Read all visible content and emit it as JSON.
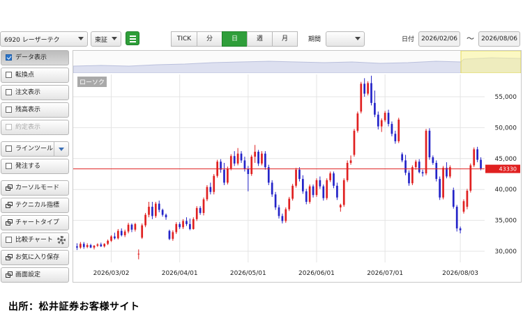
{
  "toolbar": {
    "stock_select": "6920 レーザーテク",
    "market_select": "東証",
    "period_tabs": [
      "TICK",
      "分",
      "日",
      "週",
      "月"
    ],
    "active_tab": "日",
    "period_label": "期間",
    "period_value": "",
    "date_label": "日付",
    "date_from": "2026/02/06",
    "date_sep": "～",
    "date_to": "2026/08/06"
  },
  "sidebar": {
    "items": [
      {
        "label": "データ表示",
        "kind": "checkbox",
        "checked": true,
        "active": true
      },
      {
        "label": "転換点",
        "kind": "checkbox"
      },
      {
        "label": "注文表示",
        "kind": "checkbox"
      },
      {
        "label": "残高表示",
        "kind": "checkbox"
      },
      {
        "label": "約定表示",
        "kind": "checkbox",
        "disabled": true
      },
      {
        "label": "ラインツール",
        "kind": "checkbox-dropdown"
      },
      {
        "label": "発注する",
        "kind": "checkbox"
      },
      {
        "label": "カーソルモード",
        "kind": "window"
      },
      {
        "label": "テクニカル指標",
        "kind": "window"
      },
      {
        "label": "チャートタイプ",
        "kind": "window"
      },
      {
        "label": "比較チャート",
        "kind": "checkbox-gear"
      },
      {
        "label": "お気に入り保存",
        "kind": "window"
      },
      {
        "label": "画面設定",
        "kind": "window"
      }
    ]
  },
  "chart_data": {
    "type": "candlestick",
    "title": "ローソク",
    "y_ticks": [
      "55,000",
      "50,000",
      "45,000",
      "40,000",
      "35,000",
      "30,000"
    ],
    "y_tick_values": [
      55000,
      50000,
      45000,
      40000,
      35000,
      30000
    ],
    "ylim": [
      28200,
      58600
    ],
    "x_ticks": [
      "2026/03/02",
      "2026/04/01",
      "2026/05/01",
      "2026/06/01",
      "2026/07/01",
      "2026/08/03"
    ],
    "x_tick_index": [
      10,
      30,
      50,
      70,
      90,
      112
    ],
    "current_price": 43330,
    "current_price_label": "43330",
    "up_color": "#e02020",
    "down_color": "#2424c8",
    "ohlc": [
      [
        30800,
        31300,
        30200,
        30600
      ],
      [
        30600,
        31500,
        30400,
        31200
      ],
      [
        31200,
        31500,
        30400,
        30700
      ],
      [
        30700,
        31300,
        30500,
        31000
      ],
      [
        31000,
        31200,
        30500,
        30600
      ],
      [
        30600,
        31000,
        30300,
        30900
      ],
      [
        30900,
        31300,
        30700,
        31100
      ],
      [
        31100,
        31400,
        30700,
        30800
      ],
      [
        30800,
        31300,
        30600,
        31200
      ],
      [
        31200,
        31900,
        31000,
        31700
      ],
      [
        31700,
        32600,
        31500,
        32400
      ],
      [
        32400,
        33000,
        31900,
        32100
      ],
      [
        32100,
        33600,
        31900,
        33300
      ],
      [
        33300,
        33700,
        32400,
        32600
      ],
      [
        32600,
        33500,
        32300,
        33200
      ],
      [
        33200,
        34600,
        32900,
        34300
      ],
      [
        34300,
        34500,
        33100,
        33500
      ],
      [
        33500,
        34600,
        33200,
        34400
      ],
      [
        29500,
        30300,
        28700,
        29600
      ],
      [
        32200,
        34500,
        32000,
        34200
      ],
      [
        34200,
        36200,
        33900,
        35900
      ],
      [
        35900,
        38000,
        35500,
        37200
      ],
      [
        37200,
        38000,
        35200,
        35700
      ],
      [
        35700,
        38000,
        35400,
        37700
      ],
      [
        37700,
        38200,
        36300,
        36700
      ],
      [
        36700,
        36900,
        35600,
        35900
      ],
      [
        35900,
        36100,
        35100,
        35500
      ],
      [
        33300,
        33500,
        31800,
        32000
      ],
      [
        32000,
        33400,
        31700,
        33100
      ],
      [
        33100,
        34700,
        32800,
        34400
      ],
      [
        34400,
        34700,
        33600,
        33900
      ],
      [
        33900,
        35200,
        33600,
        34900
      ],
      [
        34900,
        35500,
        34100,
        34400
      ],
      [
        34400,
        35300,
        33400,
        33600
      ],
      [
        33600,
        35500,
        33500,
        35200
      ],
      [
        35200,
        37300,
        34900,
        37000
      ],
      [
        37000,
        37300,
        35900,
        36200
      ],
      [
        36200,
        38700,
        35800,
        38400
      ],
      [
        38400,
        40700,
        38100,
        40400
      ],
      [
        40400,
        41100,
        39200,
        39600
      ],
      [
        39600,
        42500,
        39200,
        42200
      ],
      [
        42200,
        44800,
        41900,
        44500
      ],
      [
        44500,
        44900,
        42700,
        43200
      ],
      [
        43200,
        44300,
        40700,
        41100
      ],
      [
        41100,
        43700,
        40800,
        43400
      ],
      [
        43400,
        45700,
        43100,
        45400
      ],
      [
        45400,
        46200,
        43800,
        44200
      ],
      [
        44200,
        46700,
        43900,
        45800
      ],
      [
        45800,
        46200,
        44300,
        44700
      ],
      [
        44700,
        45300,
        42900,
        43300
      ],
      [
        43300,
        43800,
        39700,
        42500
      ],
      [
        42500,
        45600,
        42200,
        45300
      ],
      [
        45300,
        47200,
        44300,
        46100
      ],
      [
        46100,
        46400,
        43800,
        44200
      ],
      [
        44200,
        46200,
        43900,
        45800
      ],
      [
        45800,
        46200,
        43200,
        43600
      ],
      [
        43600,
        44000,
        40700,
        41100
      ],
      [
        41100,
        41500,
        38800,
        39200
      ],
      [
        39200,
        39600,
        36700,
        37100
      ],
      [
        37100,
        37500,
        35300,
        35700
      ],
      [
        35700,
        36100,
        34500,
        34900
      ],
      [
        34900,
        37100,
        34600,
        36800
      ],
      [
        36800,
        38800,
        36500,
        38500
      ],
      [
        38500,
        40900,
        38200,
        40600
      ],
      [
        40600,
        43500,
        40300,
        43200
      ],
      [
        43200,
        43600,
        41300,
        41700
      ],
      [
        41700,
        42300,
        39300,
        39700
      ],
      [
        39700,
        40100,
        37600,
        38000
      ],
      [
        38000,
        40800,
        37700,
        40500
      ],
      [
        40500,
        40800,
        38700,
        39100
      ],
      [
        39100,
        41800,
        38800,
        41500
      ],
      [
        41500,
        42100,
        40100,
        40500
      ],
      [
        40500,
        40800,
        38200,
        38600
      ],
      [
        38600,
        41800,
        38300,
        41500
      ],
      [
        41500,
        42900,
        41200,
        42600
      ],
      [
        42600,
        42900,
        40200,
        40600
      ],
      [
        40600,
        41100,
        38300,
        38700
      ],
      [
        37100,
        37700,
        36400,
        37500
      ],
      [
        37500,
        41800,
        37200,
        41500
      ],
      [
        41500,
        44700,
        41200,
        44300
      ],
      [
        44300,
        45500,
        44000,
        44700
      ],
      [
        45600,
        49800,
        45300,
        49500
      ],
      [
        49500,
        52600,
        49200,
        52300
      ],
      [
        52600,
        57400,
        52300,
        57100
      ],
      [
        57100,
        58000,
        55000,
        55500
      ],
      [
        55500,
        57500,
        55200,
        57200
      ],
      [
        57200,
        58400,
        53600,
        54000
      ],
      [
        54000,
        56000,
        51700,
        52100
      ],
      [
        52100,
        52600,
        49700,
        50200
      ],
      [
        50200,
        51500,
        49300,
        51200
      ],
      [
        51200,
        52700,
        50900,
        52400
      ],
      [
        52400,
        52900,
        50200,
        50600
      ],
      [
        50600,
        51000,
        48600,
        49000
      ],
      [
        49000,
        49500,
        47400,
        47800
      ],
      [
        47800,
        51600,
        47500,
        51300
      ],
      [
        45700,
        46000,
        44400,
        44700
      ],
      [
        44700,
        45600,
        42300,
        42700
      ],
      [
        42700,
        43100,
        40600,
        41000
      ],
      [
        41000,
        43900,
        40700,
        43600
      ],
      [
        43600,
        44800,
        43200,
        44500
      ],
      [
        44500,
        44900,
        42600,
        42800
      ],
      [
        42800,
        43200,
        42100,
        42600
      ],
      [
        42600,
        49800,
        42300,
        49500
      ],
      [
        49500,
        49900,
        44800,
        45200
      ],
      [
        45200,
        45500,
        44000,
        44300
      ],
      [
        44300,
        44700,
        41300,
        41700
      ],
      [
        41700,
        42100,
        38300,
        38700
      ],
      [
        38700,
        43800,
        38400,
        43500
      ],
      [
        43500,
        44400,
        41800,
        42100
      ],
      [
        42100,
        43900,
        41800,
        43600
      ],
      [
        39900,
        40300,
        36900,
        37200
      ],
      [
        37200,
        37500,
        33200,
        33700
      ],
      [
        33700,
        34000,
        32900,
        33400
      ],
      [
        36400,
        38400,
        36100,
        38100
      ],
      [
        37200,
        40100,
        36800,
        39800
      ],
      [
        39800,
        44200,
        39500,
        43900
      ],
      [
        43900,
        46800,
        43600,
        46500
      ],
      [
        46500,
        46900,
        44400,
        44800
      ],
      [
        44800,
        45200,
        43100,
        43400
      ]
    ]
  },
  "source_text": "出所：松井証券お客様サイト"
}
